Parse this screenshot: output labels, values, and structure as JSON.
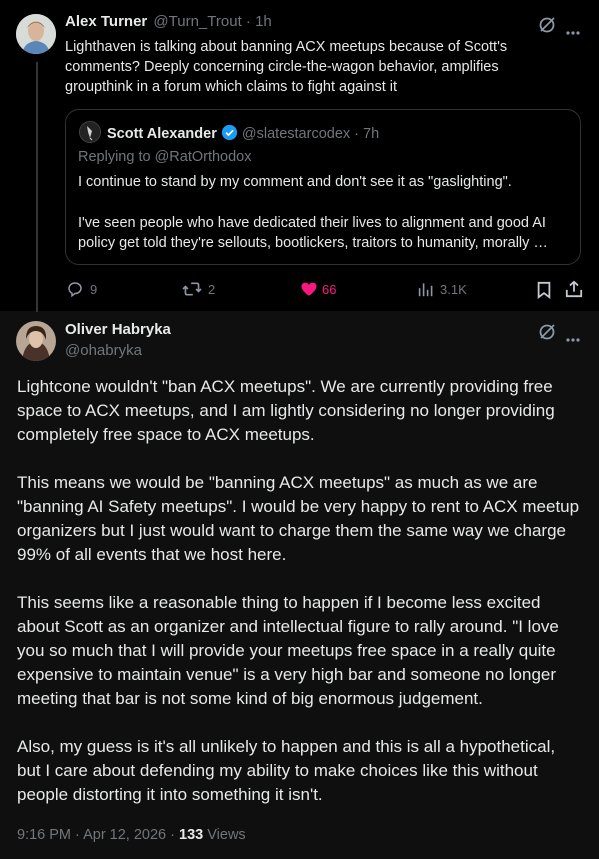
{
  "tweet1": {
    "author_name": "Alex Turner",
    "handle": "@Turn_Trout",
    "time": "· 1h",
    "text": "Lighthaven is talking about banning ACX meetups because of Scott's comments? Deeply concerning circle-the-wagon behavior, amplifies groupthink in a forum which claims to fight against it",
    "quote": {
      "author_name": "Scott Alexander",
      "handle": "@slatestarcodex",
      "time": "· 7h",
      "replying_to": "Replying to @RatOrthodox",
      "line1": "I continue to stand by my comment and don't see it as \"gaslighting\".",
      "line2a": "I've seen people who have dedicated their lives to alignment and good AI",
      "line2b": "policy get told they're sellouts, bootlickers, traitors to humanity, morally …"
    },
    "actions": {
      "replies": "9",
      "reposts": "2",
      "likes": "66",
      "views": "3.1K"
    }
  },
  "tweet2": {
    "author_name": "Oliver Habryka",
    "handle": "@ohabryka",
    "paragraphs": [
      "Lightcone wouldn't \"ban ACX meetups\". We are currently providing free space to ACX meetups, and I am lightly considering no longer providing completely free space to ACX meetups.",
      "This means we would be \"banning ACX meetups\" as much as we are \"banning AI Safety meetups\". I would be very happy to rent to ACX meetup organizers but I just would want to charge them the same way we charge 99% of all events that we host here.",
      "This seems like a reasonable thing to happen if I become less excited about Scott as an organizer and intellectual figure to rally around. \"I love you so much that I will provide your meetups free space in a really quite expensive to maintain venue\" is a very high bar and someone no longer meeting that bar is not some kind of big enormous judgement.",
      "Also, my guess is it's all unlikely to happen and this is all a hypothetical, but I care about defending my ability to make choices like this without people distorting it into something it isn't."
    ],
    "timestamp": "9:16 PM · Apr 12, 2026 ·",
    "views_count": "133",
    "views_label": "Views"
  },
  "colors": {
    "like_pink": "#f91880",
    "verified_blue": "#1d9bf0",
    "muted": "#71767b"
  }
}
